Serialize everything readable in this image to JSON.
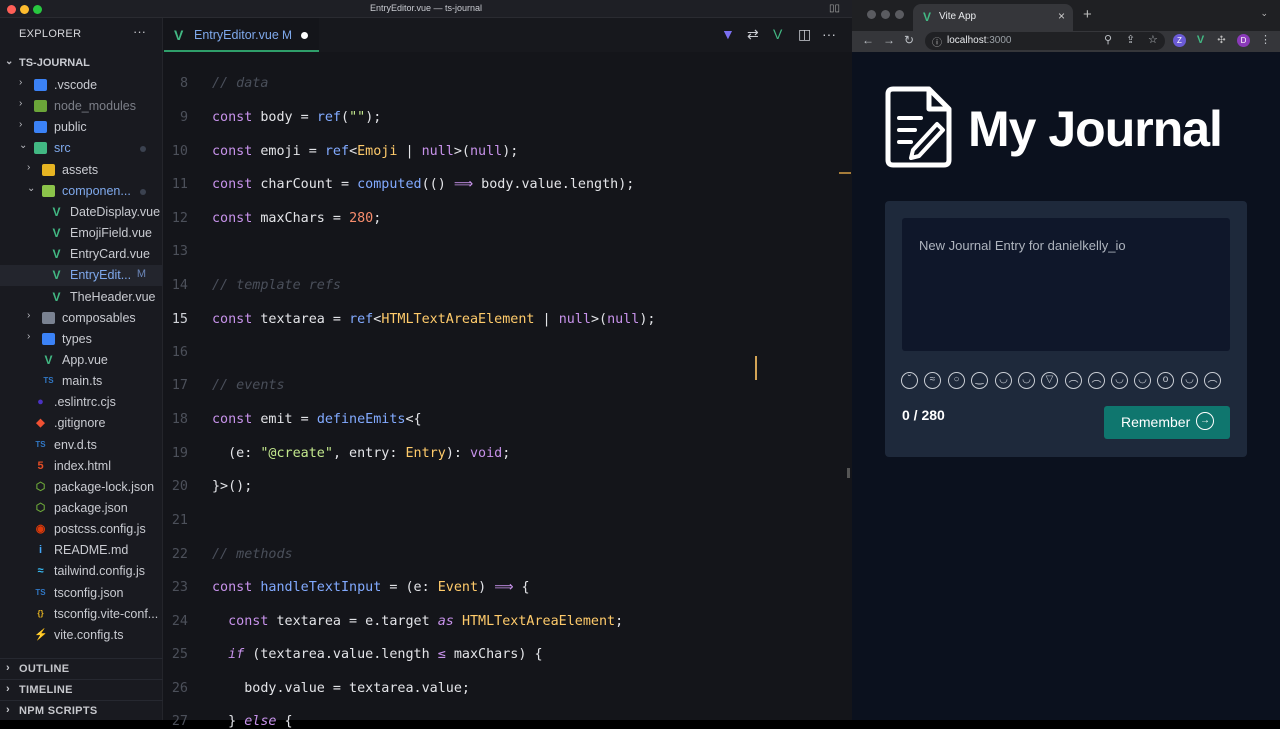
{
  "window_title": "EntryEditor.vue — ts-journal",
  "explorer": {
    "title": "EXPLORER",
    "project": "TS-JOURNAL",
    "items": [
      {
        "label": ".vscode"
      },
      {
        "label": "node_modules"
      },
      {
        "label": "public"
      },
      {
        "label": "src"
      },
      {
        "label": "assets"
      },
      {
        "label": "componen..."
      },
      {
        "label": "DateDisplay.vue"
      },
      {
        "label": "EmojiField.vue"
      },
      {
        "label": "EntryCard.vue"
      },
      {
        "label": "EntryEdit...",
        "mark": "M"
      },
      {
        "label": "TheHeader.vue"
      },
      {
        "label": "composables"
      },
      {
        "label": "types"
      },
      {
        "label": "App.vue"
      },
      {
        "label": "main.ts"
      },
      {
        "label": ".eslintrc.cjs"
      },
      {
        "label": ".gitignore"
      },
      {
        "label": "env.d.ts"
      },
      {
        "label": "index.html"
      },
      {
        "label": "package-lock.json"
      },
      {
        "label": "package.json"
      },
      {
        "label": "postcss.config.js"
      },
      {
        "label": "README.md"
      },
      {
        "label": "tailwind.config.js"
      },
      {
        "label": "tsconfig.json"
      },
      {
        "label": "tsconfig.vite-conf..."
      },
      {
        "label": "vite.config.ts"
      }
    ],
    "panels": [
      "OUTLINE",
      "TIMELINE",
      "NPM SCRIPTS"
    ]
  },
  "editor": {
    "tab_name": "EntryEditor.vue",
    "tab_mark": "M",
    "current_line": "15",
    "lines": [
      {
        "n": "8"
      },
      {
        "n": "9"
      },
      {
        "n": "10"
      },
      {
        "n": "11"
      },
      {
        "n": "12"
      },
      {
        "n": "13"
      },
      {
        "n": "14"
      },
      {
        "n": "15"
      },
      {
        "n": "16"
      },
      {
        "n": "17"
      },
      {
        "n": "18"
      },
      {
        "n": "19"
      },
      {
        "n": "20"
      },
      {
        "n": "21"
      },
      {
        "n": "22"
      },
      {
        "n": "23"
      },
      {
        "n": "24"
      },
      {
        "n": "25"
      },
      {
        "n": "26"
      },
      {
        "n": "27"
      }
    ]
  },
  "browser": {
    "tab_title": "Vite App",
    "url_host": "localhost",
    "url_port": ":3000",
    "profile_initial": "D"
  },
  "app": {
    "title": "My Journal",
    "placeholder": "New Journal Entry for danielkelly_io",
    "char_count": "0 / 280",
    "submit_label": "Remember"
  },
  "colors": {
    "keyword": "#c792ea",
    "string": "#c3e88d",
    "number": "#f78c6c",
    "type": "#ffcb6b",
    "function": "#82aaff",
    "comment": "#4a4f5a",
    "accent": "#0f766e"
  }
}
